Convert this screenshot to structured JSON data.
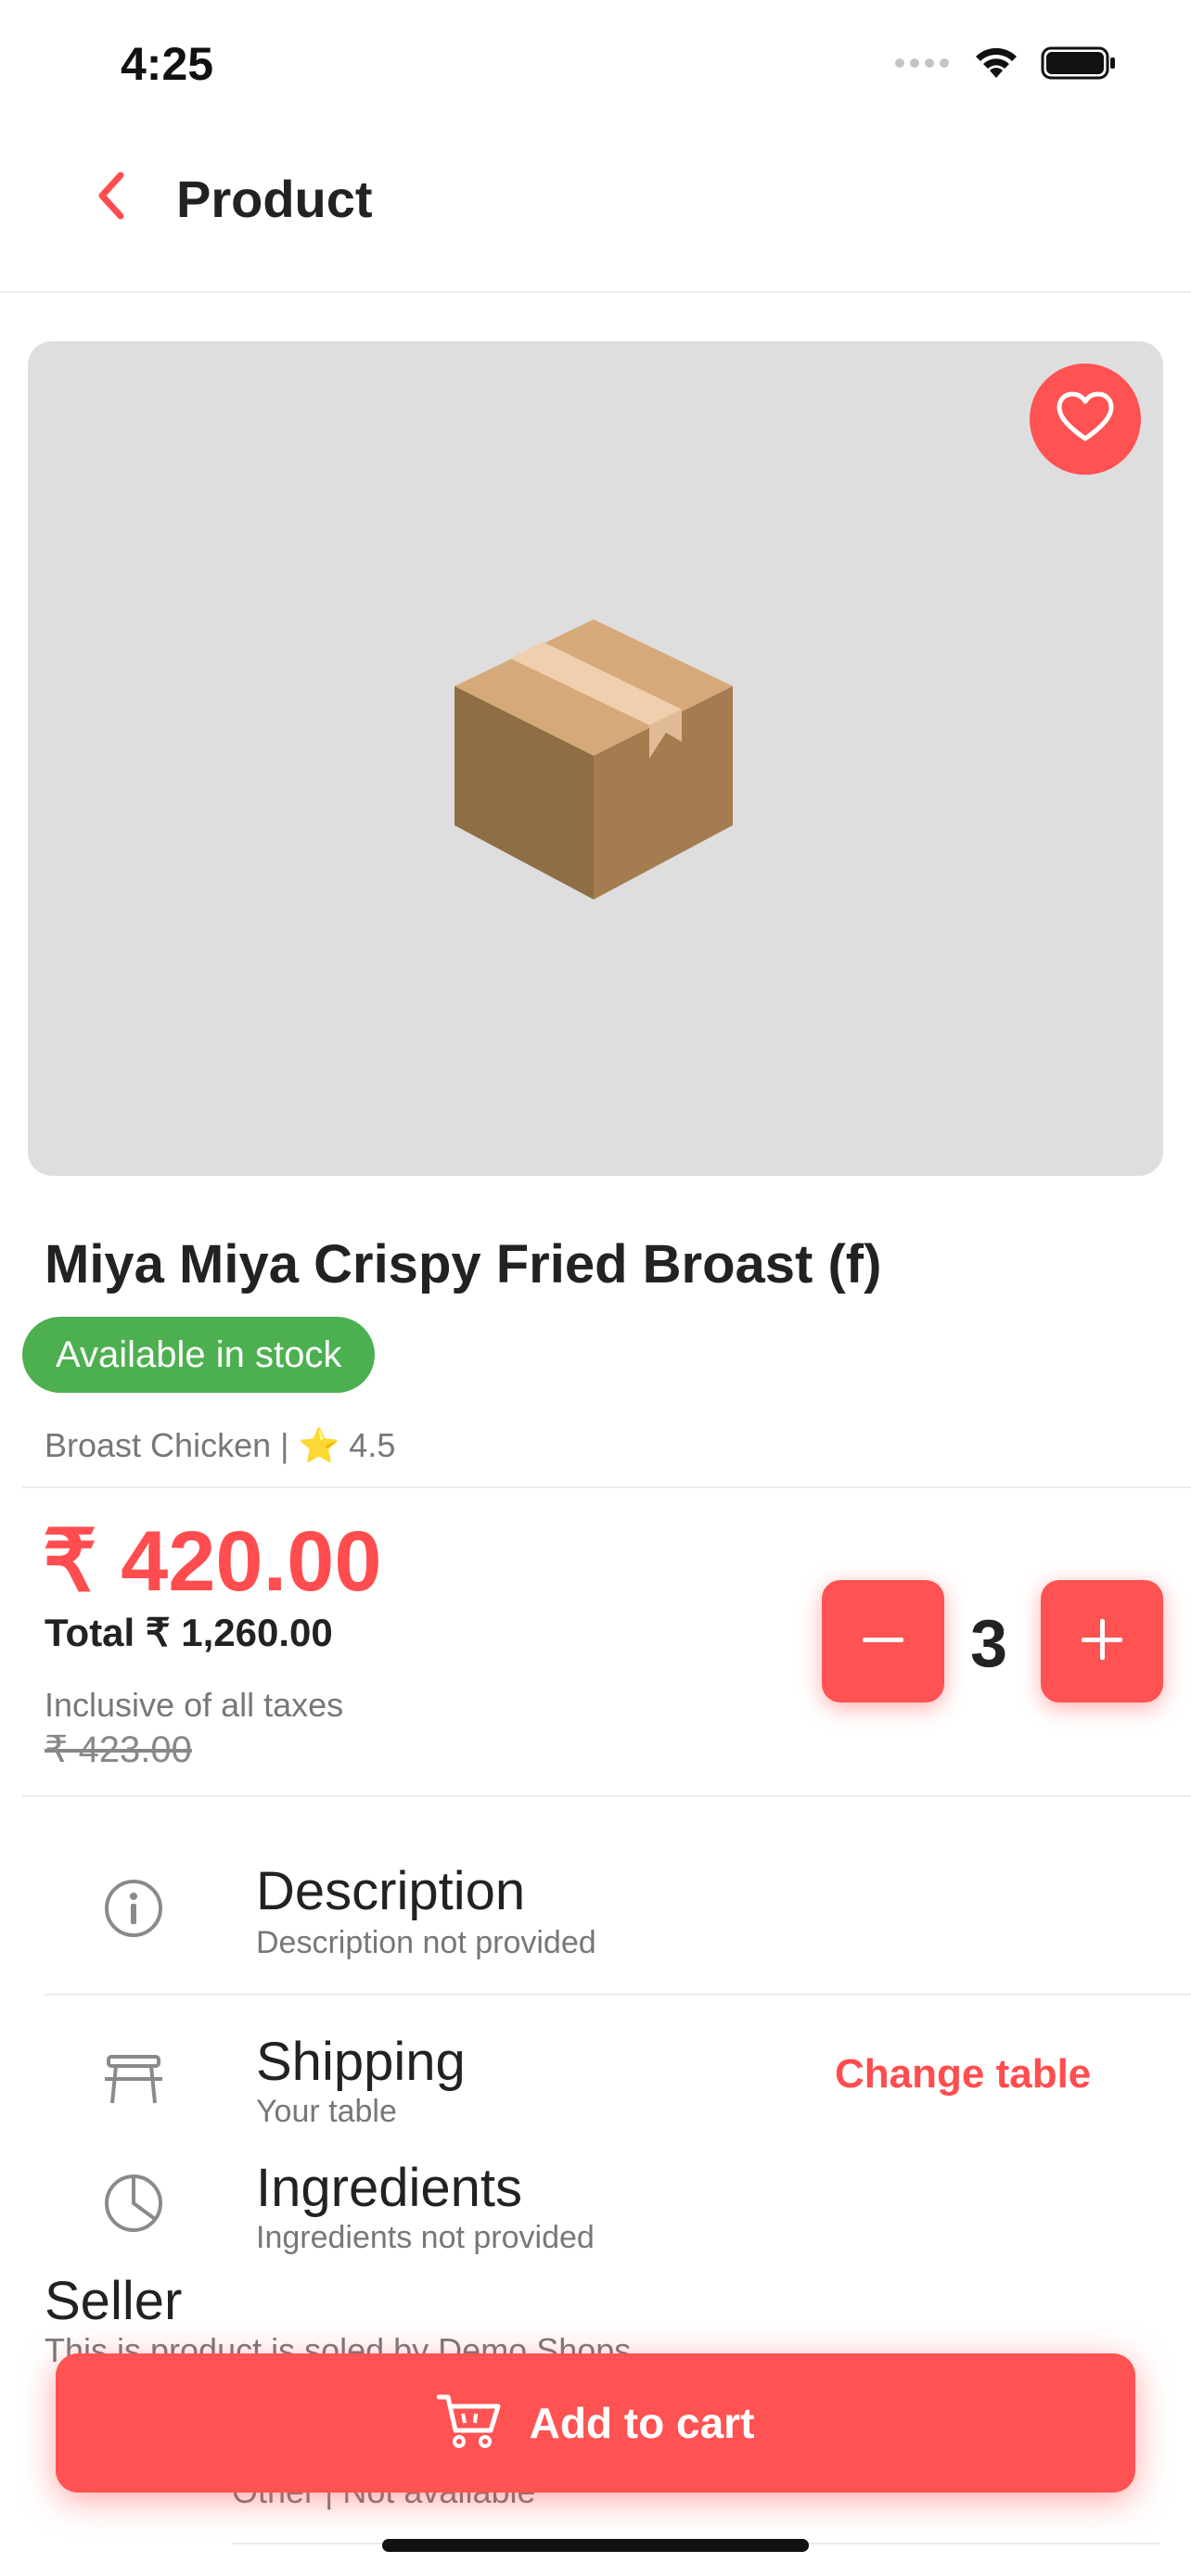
{
  "status_bar": {
    "time": "4:25",
    "icons": [
      "signal-icon",
      "wifi-icon",
      "battery-icon"
    ]
  },
  "header": {
    "title": "Product",
    "back_icon": "chevron-left-icon"
  },
  "product": {
    "name": "Miya Miya Crispy Fried Broast (f)",
    "stock_badge": "Available in stock",
    "category_rating": "Broast Chicken | ⭐ 4.5",
    "price": "₹ 420.00",
    "total": "Total  ₹ 1,260.00",
    "tax_note": "Inclusive of all taxes",
    "old_price": "₹ 423.00",
    "quantity": "3",
    "image_placeholder": "box-icon"
  },
  "sections": {
    "description": {
      "title": "Description",
      "subtitle": "Description not provided",
      "icon": "info-icon"
    },
    "shipping": {
      "title": "Shipping",
      "subtitle": "Your table",
      "action": "Change table",
      "icon": "table-icon"
    },
    "ingredients": {
      "title": "Ingredients",
      "subtitle": "Ingredients not provided",
      "icon": "pie-chart-icon"
    },
    "seller": {
      "title": "Seller",
      "subtitle": "This is product is soled by Demo Shops",
      "other": "Other | Not available"
    }
  },
  "cart_button": {
    "label": "Add to cart",
    "icon": "cart-icon"
  },
  "colors": {
    "accent": "#ff5252",
    "stock_green": "#4caf50",
    "image_bg": "#dedede"
  }
}
